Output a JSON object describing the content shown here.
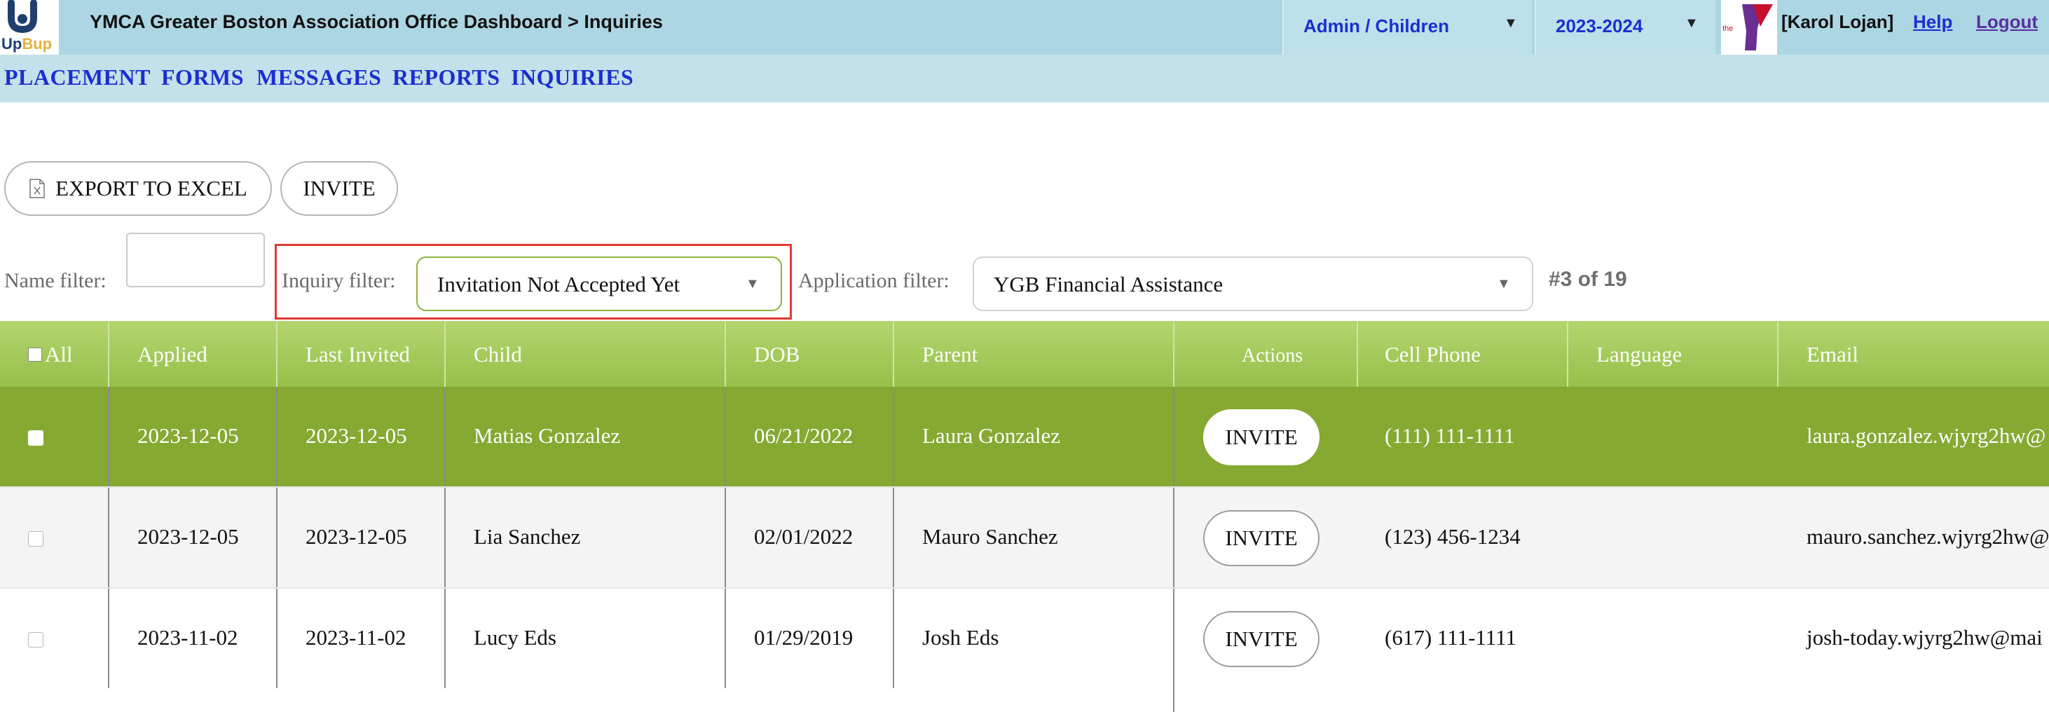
{
  "header": {
    "logo": {
      "text_up": "Up",
      "text_bup": "Bup"
    },
    "title": "YMCA Greater Boston Association Office Dashboard > Inquiries",
    "role_select": "Admin / Children",
    "year_select": "2023-2024",
    "user": "[Karol Lojan]",
    "help": "Help",
    "logout": "Logout"
  },
  "nav": [
    "PLACEMENT",
    "FORMS",
    "MESSAGES",
    "REPORTS",
    "INQUIRIES"
  ],
  "toolbar": {
    "export_label": "EXPORT TO EXCEL",
    "invite_label": "INVITE"
  },
  "filters": {
    "name_label": "Name filter:",
    "name_value": "",
    "inquiry_label": "Inquiry filter:",
    "inquiry_value": "Invitation Not Accepted Yet",
    "application_label": "Application filter:",
    "application_value": "YGB Financial Assistance",
    "count": "#3 of 19"
  },
  "table": {
    "columns": [
      "All",
      "Applied",
      "Last Invited",
      "Child",
      "DOB",
      "Parent",
      "Actions",
      "Cell Phone",
      "Language",
      "Email"
    ],
    "action_label": "INVITE",
    "rows": [
      {
        "applied": "2023-12-05",
        "last_invited": "2023-12-05",
        "child": "Matias Gonzalez",
        "dob": "06/21/2022",
        "parent": "Laura Gonzalez",
        "phone": "(111) 111-1111",
        "language": "",
        "email": "laura.gonzalez.wjyrg2hw@"
      },
      {
        "applied": "2023-12-05",
        "last_invited": "2023-12-05",
        "child": "Lia Sanchez",
        "dob": "02/01/2022",
        "parent": "Mauro Sanchez",
        "phone": "(123) 456-1234",
        "language": "",
        "email": "mauro.sanchez.wjyrg2hw@"
      },
      {
        "applied": "2023-11-02",
        "last_invited": "2023-11-02",
        "child": "Lucy Eds",
        "dob": "01/29/2019",
        "parent": "Josh Eds",
        "phone": "(617) 111-1111",
        "language": "",
        "email": "josh-today.wjyrg2hw@mai"
      }
    ]
  },
  "colors": {
    "topbar": "#acd6e3",
    "navbar": "#c3e1ea",
    "nav_link": "#1a2fd0",
    "header_green": "#a4c95c",
    "selected_row": "#86a932",
    "highlight": "#e03a30"
  }
}
